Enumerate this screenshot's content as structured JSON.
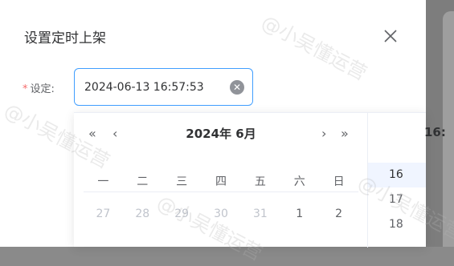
{
  "dialog": {
    "title": "设置定时上架"
  },
  "form": {
    "required_mark": "*",
    "label": "设定:",
    "datetime_value": "2024-06-13 16:57:53",
    "clear_icon": "clear-circle-icon"
  },
  "calendar": {
    "nav_prev_year": "«",
    "nav_prev_month": "‹",
    "nav_next_month": "›",
    "nav_next_year": "»",
    "title": "2024年 6月",
    "weekdays": [
      "一",
      "二",
      "三",
      "四",
      "五",
      "六",
      "日"
    ],
    "first_row": [
      {
        "day": "27",
        "muted": true
      },
      {
        "day": "28",
        "muted": true
      },
      {
        "day": "29",
        "muted": true
      },
      {
        "day": "30",
        "muted": true
      },
      {
        "day": "31",
        "muted": true
      },
      {
        "day": "1",
        "muted": false
      },
      {
        "day": "2",
        "muted": false
      }
    ]
  },
  "time": {
    "title": "16:",
    "hours": [
      "16",
      "17",
      "18"
    ],
    "selected_hour": "16"
  },
  "watermark": "@小吴懂运营",
  "colors": {
    "accent": "#409eff",
    "required": "#f56c6c"
  }
}
